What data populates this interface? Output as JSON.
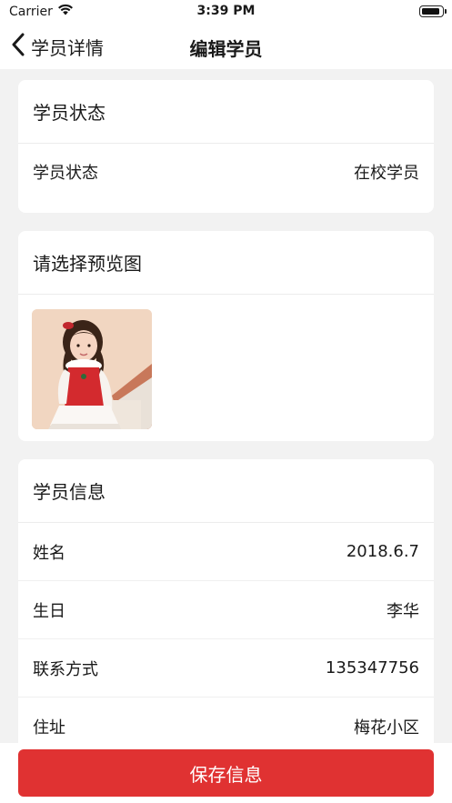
{
  "status_bar": {
    "carrier": "Carrier",
    "time": "3:39 PM"
  },
  "nav": {
    "back_label": "学员详情",
    "title": "编辑学员"
  },
  "status_section": {
    "header": "学员状态",
    "rows": [
      {
        "label": "学员状态",
        "value": "在校学员"
      }
    ]
  },
  "photo_section": {
    "header": "请选择预览图"
  },
  "info_section": {
    "header": "学员信息",
    "rows": [
      {
        "label": "姓名",
        "value": "2018.6.7"
      },
      {
        "label": "生日",
        "value": "李华"
      },
      {
        "label": "联系方式",
        "value": "135347756"
      },
      {
        "label": "住址",
        "value": "梅花小区"
      }
    ]
  },
  "footer": {
    "save_label": "保存信息"
  },
  "colors": {
    "accent": "#e03232",
    "background": "#f2f2f2"
  },
  "icons": {
    "back": "chevron-left-icon",
    "wifi": "wifi-icon",
    "battery": "battery-icon"
  }
}
